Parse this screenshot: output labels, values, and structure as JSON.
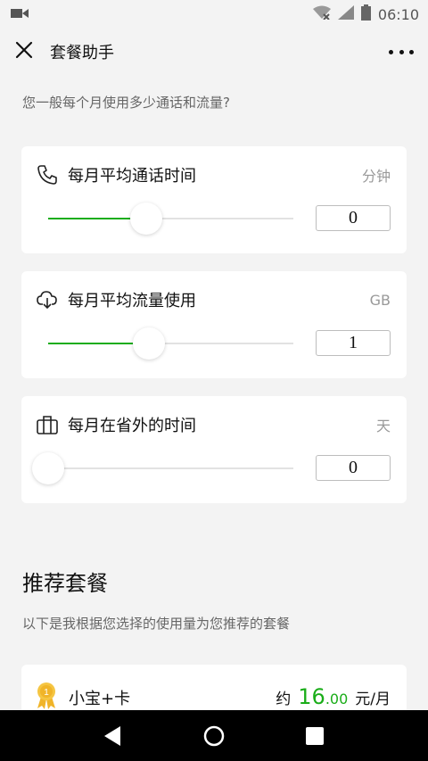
{
  "status_bar": {
    "time": "06:10"
  },
  "nav": {
    "title": "套餐助手"
  },
  "question": "您一般每个月使用多少通话和流量?",
  "sliders": [
    {
      "title": "每月平均通话时间",
      "unit": "分钟",
      "value": "0",
      "icon": "phone-icon",
      "fill_fraction": 0.4
    },
    {
      "title": "每月平均流量使用",
      "unit": "GB",
      "value": "1",
      "icon": "cloud-download-icon",
      "fill_fraction": 0.41
    },
    {
      "title": "每月在省外的时间",
      "unit": "天",
      "value": "0",
      "icon": "suitcase-icon",
      "fill_fraction": 0.0
    }
  ],
  "recommend": {
    "title": "推荐套餐",
    "subtitle": "以下是我根据您选择的使用量为您推荐的套餐"
  },
  "plan": {
    "rank": "1",
    "name": "小宝+卡",
    "price_prefix": "约",
    "price_int": "16",
    "price_dec": ".00",
    "price_unit": "元/月"
  },
  "colors": {
    "accent": "#1aad19",
    "background": "#f3f3f3"
  }
}
